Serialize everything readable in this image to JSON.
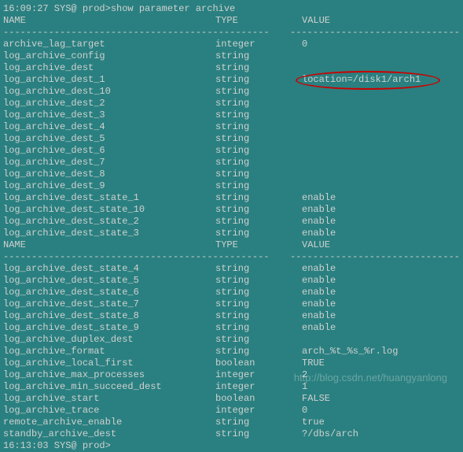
{
  "prompt": "16:09:27 SYS@ prod>show parameter archive",
  "headers": {
    "name": "NAME",
    "type": "TYPE",
    "value": "VALUE"
  },
  "dash": {
    "name": "------------------------------------",
    "type": "-----------",
    "value": "------------------------------"
  },
  "section1": [
    {
      "name": "archive_lag_target",
      "type": "integer",
      "value": "0"
    },
    {
      "name": "log_archive_config",
      "type": "string",
      "value": ""
    },
    {
      "name": "log_archive_dest",
      "type": "string",
      "value": ""
    },
    {
      "name": "log_archive_dest_1",
      "type": "string",
      "value": "location=/disk1/arch1",
      "circled": true
    },
    {
      "name": "log_archive_dest_10",
      "type": "string",
      "value": ""
    },
    {
      "name": "log_archive_dest_2",
      "type": "string",
      "value": ""
    },
    {
      "name": "log_archive_dest_3",
      "type": "string",
      "value": ""
    },
    {
      "name": "log_archive_dest_4",
      "type": "string",
      "value": ""
    },
    {
      "name": "log_archive_dest_5",
      "type": "string",
      "value": ""
    },
    {
      "name": "log_archive_dest_6",
      "type": "string",
      "value": ""
    },
    {
      "name": "log_archive_dest_7",
      "type": "string",
      "value": ""
    },
    {
      "name": "log_archive_dest_8",
      "type": "string",
      "value": ""
    },
    {
      "name": "log_archive_dest_9",
      "type": "string",
      "value": ""
    },
    {
      "name": "log_archive_dest_state_1",
      "type": "string",
      "value": "enable"
    },
    {
      "name": "log_archive_dest_state_10",
      "type": "string",
      "value": "enable"
    },
    {
      "name": "log_archive_dest_state_2",
      "type": "string",
      "value": "enable"
    },
    {
      "name": "log_archive_dest_state_3",
      "type": "string",
      "value": "enable"
    }
  ],
  "section2": [
    {
      "name": "log_archive_dest_state_4",
      "type": "string",
      "value": "enable"
    },
    {
      "name": "log_archive_dest_state_5",
      "type": "string",
      "value": "enable"
    },
    {
      "name": "log_archive_dest_state_6",
      "type": "string",
      "value": "enable"
    },
    {
      "name": "log_archive_dest_state_7",
      "type": "string",
      "value": "enable"
    },
    {
      "name": "log_archive_dest_state_8",
      "type": "string",
      "value": "enable"
    },
    {
      "name": "log_archive_dest_state_9",
      "type": "string",
      "value": "enable"
    },
    {
      "name": "log_archive_duplex_dest",
      "type": "string",
      "value": ""
    },
    {
      "name": "log_archive_format",
      "type": "string",
      "value": "arch_%t_%s_%r.log"
    },
    {
      "name": "log_archive_local_first",
      "type": "boolean",
      "value": "TRUE"
    },
    {
      "name": "log_archive_max_processes",
      "type": "integer",
      "value": "2"
    },
    {
      "name": "log_archive_min_succeed_dest",
      "type": "integer",
      "value": "1"
    },
    {
      "name": "log_archive_start",
      "type": "boolean",
      "value": "FALSE"
    },
    {
      "name": "log_archive_trace",
      "type": "integer",
      "value": "0"
    },
    {
      "name": "remote_archive_enable",
      "type": "string",
      "value": "true"
    },
    {
      "name": "standby_archive_dest",
      "type": "string",
      "value": "?/dbs/arch"
    }
  ],
  "footer_prompt": "16:13:03 SYS@ prod>",
  "watermark": "http://blog.csdn.net/huangyanlong"
}
